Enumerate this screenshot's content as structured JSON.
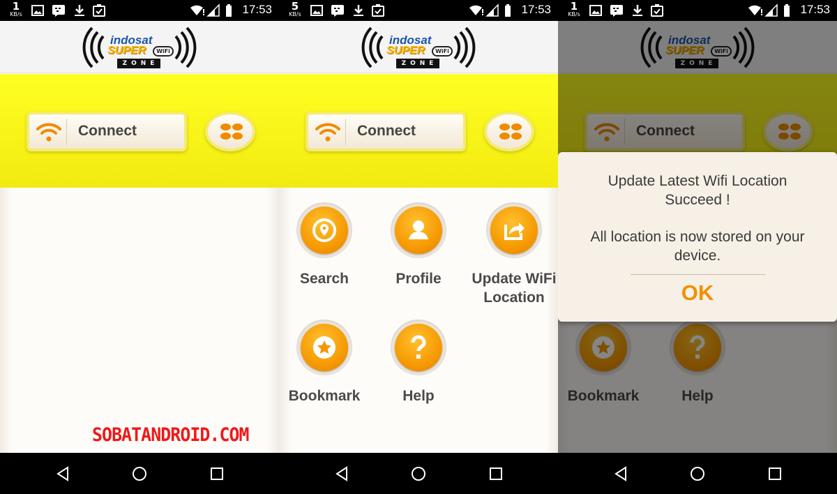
{
  "panels": [
    {
      "status": {
        "speed": "1",
        "speed_unit": "KB/s",
        "time": "17:53"
      },
      "logo": {
        "brand": "indosat",
        "super": "SUPER",
        "wifi": "WiFi",
        "zone": "ZONE"
      },
      "connect_label": "Connect",
      "watermark": "SOBATANDROID.COM"
    },
    {
      "status": {
        "speed": "5",
        "speed_unit": "KB/s",
        "time": "17:53"
      },
      "logo": {
        "brand": "indosat",
        "super": "SUPER",
        "wifi": "WiFi",
        "zone": "ZONE"
      },
      "connect_label": "Connect",
      "menu": [
        {
          "label": "Search",
          "icon": "location-pin-icon"
        },
        {
          "label": "Profile",
          "icon": "person-icon"
        },
        {
          "label": "Update WiFi Location",
          "icon": "share-icon"
        },
        {
          "label": "Bookmark",
          "icon": "star-icon"
        },
        {
          "label": "Help",
          "icon": "question-icon"
        }
      ]
    },
    {
      "status": {
        "speed": "1",
        "speed_unit": "KB/s",
        "time": "17:53"
      },
      "logo": {
        "brand": "indosat",
        "super": "SUPER",
        "wifi": "WiFi",
        "zone": "ZONE"
      },
      "connect_label": "Connect",
      "menu": [
        {
          "label": "Bookmark",
          "icon": "star-icon"
        },
        {
          "label": "Help",
          "icon": "question-icon"
        }
      ],
      "dialog": {
        "line1": "Update Latest Wifi Location",
        "line2": "Succeed !",
        "line3": "All location is now stored on your",
        "line4": "device.",
        "ok_label": "OK"
      }
    }
  ],
  "colors": {
    "accent": "#f59700",
    "band": "#ffff22",
    "watermark": "#f01818"
  }
}
